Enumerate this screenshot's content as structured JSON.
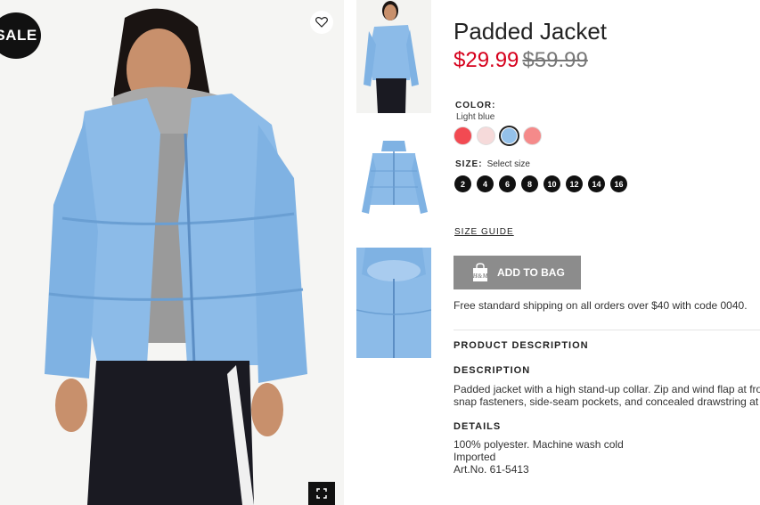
{
  "badge": {
    "sale": "SALE"
  },
  "product": {
    "title": "Padded Jacket",
    "sale_price": "$29.99",
    "original_price": "$59.99"
  },
  "color": {
    "label": "COLOR:",
    "selected": "Light blue",
    "swatches": [
      "#f24a52",
      "#f6dada",
      "#94c1ea",
      "#f58a8a"
    ],
    "selected_index": 2
  },
  "size": {
    "label": "SIZE:",
    "hint": "Select size",
    "options": [
      "2",
      "4",
      "6",
      "8",
      "10",
      "12",
      "14",
      "16"
    ]
  },
  "size_guide": "SIZE GUIDE",
  "add_to_bag": {
    "label": "ADD TO BAG",
    "bag_logo": "H&M"
  },
  "shipping": "Free standard shipping on all orders over $40 with code 0040.",
  "product_description": {
    "heading": "PRODUCT DESCRIPTION",
    "description_heading": "DESCRIPTION",
    "description_line1": "Padded jacket with a high stand-up collar. Zip and wind flap at front with",
    "description_line2": "snap fasteners, side-seam pockets, and concealed drawstring at hem.",
    "details_heading": "DETAILS",
    "details": [
      "100% polyester. Machine wash cold",
      "Imported",
      "Art.No. 61-5413"
    ]
  },
  "icons": {
    "favorite": "heart-icon",
    "fullscreen": "expand-icon",
    "bag": "shopping-bag-icon"
  },
  "colors": {
    "sale_price": "#d6001c",
    "button": "#8c8c8c",
    "jacket": "#8cbbe8"
  }
}
